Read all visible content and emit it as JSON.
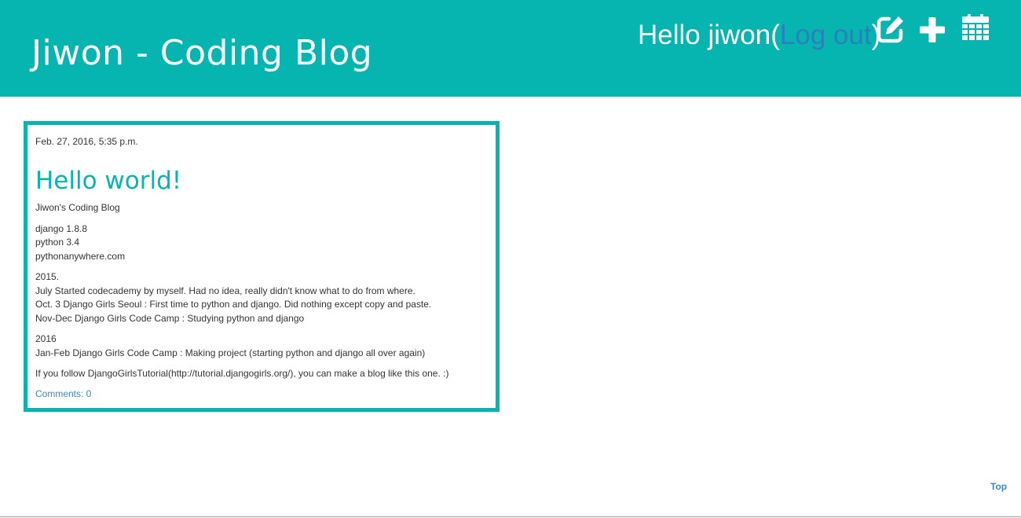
{
  "header": {
    "site_title": "Jiwon - Coding Blog",
    "greeting_prefix": "Hello jiwon",
    "open_paren": "(",
    "logout_label": "Log out",
    "close_paren": ")",
    "icons": [
      "edit-icon",
      "plus-icon",
      "calendar-icon"
    ],
    "background_color": "#06b5b0"
  },
  "post": {
    "date": "Feb. 27, 2016, 5:35 p.m.",
    "title": "Hello world!",
    "intro": "Jiwon's Coding Blog",
    "stack": [
      "django 1.8.8",
      "python 3.4",
      "pythonanywhere.com"
    ],
    "year_2015": {
      "heading": "2015.",
      "lines": [
        "July Started codecademy by myself. Had no idea, really didn't know what to do from where.",
        "Oct. 3 Django Girls Seoul : First time to python and django. Did nothing except copy and paste.",
        "Nov-Dec Django Girls Code Camp : Studying python and django"
      ]
    },
    "year_2016": {
      "heading": "2016",
      "lines": [
        "Jan-Feb Django Girls Code Camp : Making project (starting python and django all over again)"
      ]
    },
    "closing": "If you follow DjangoGirlsTutorial(http://tutorial.djangogirls.org/), you can make a blog like this one. :)",
    "comments_label": "Comments: 0"
  },
  "footer": {
    "top_label": "Top"
  }
}
